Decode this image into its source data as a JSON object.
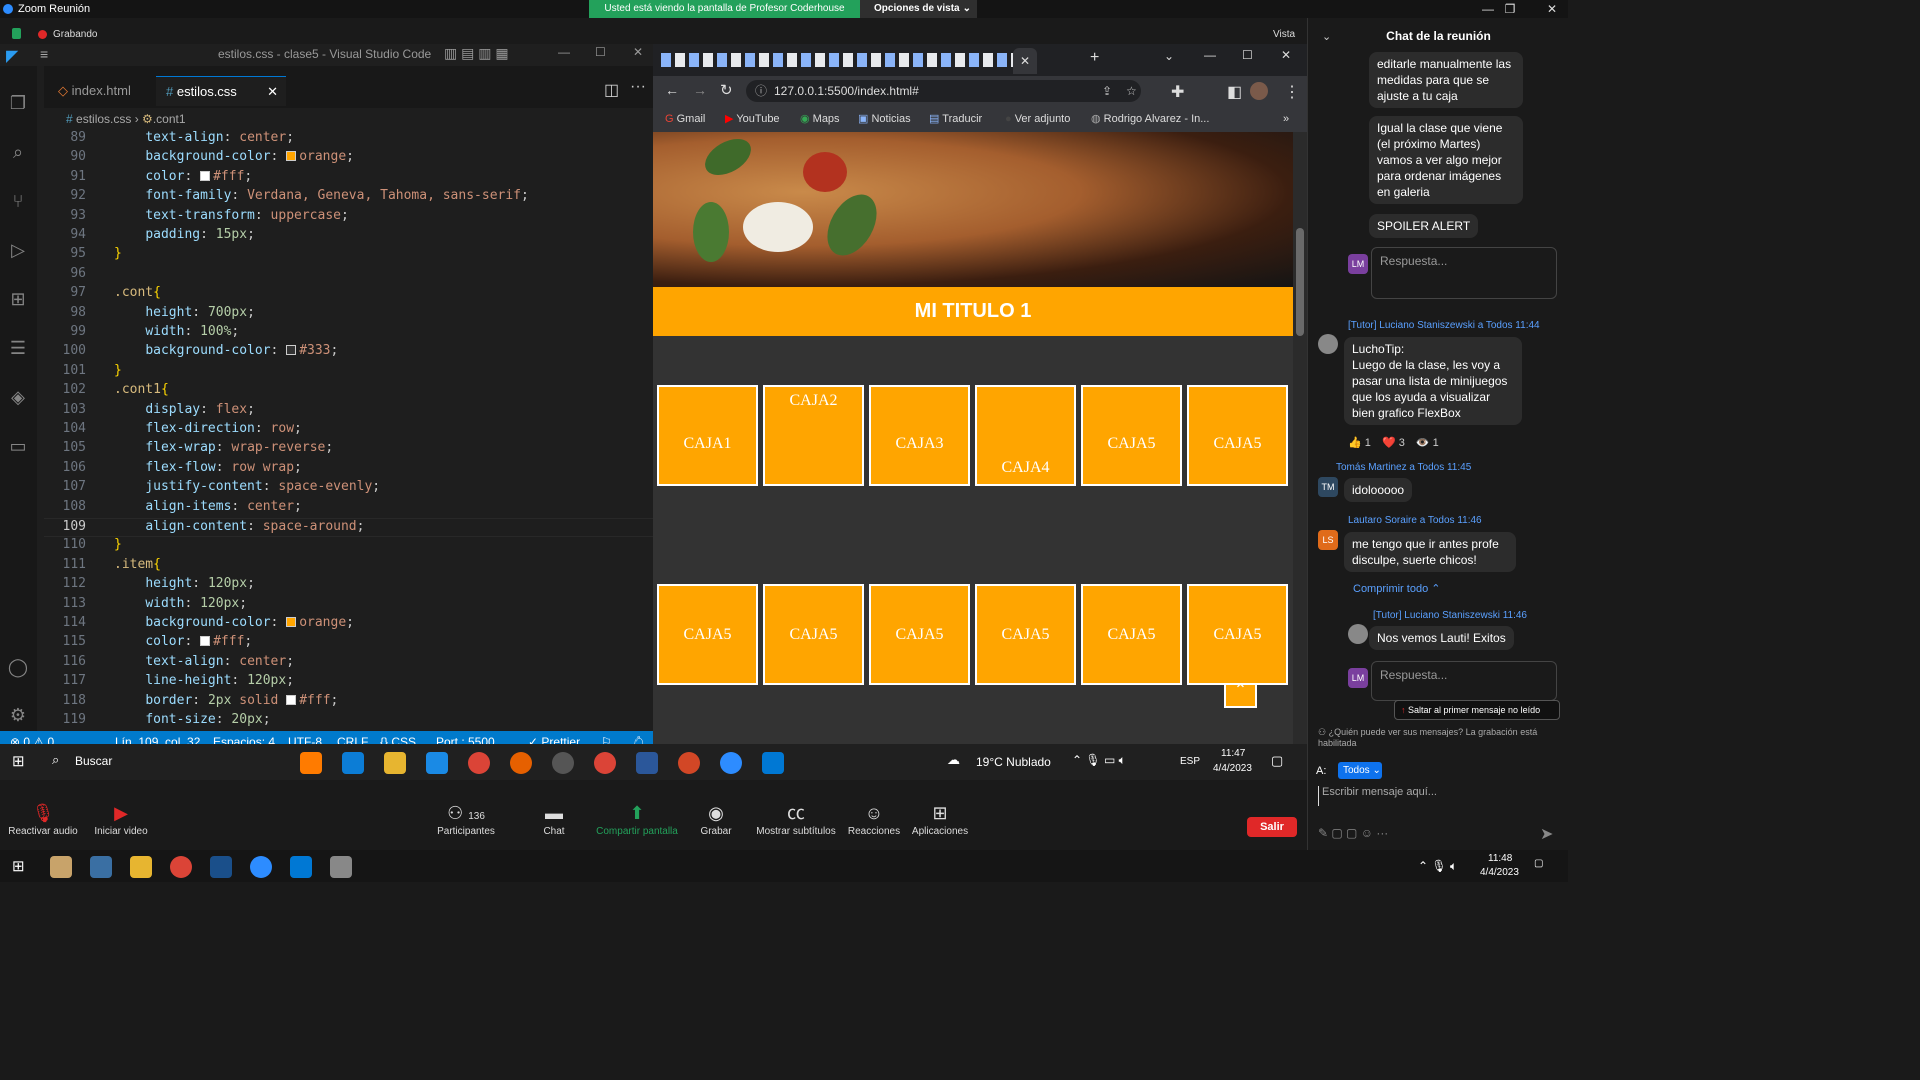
{
  "zoom": {
    "window_title": "Zoom Reunión",
    "share_banner": "Usted está viendo la pantalla de Profesor Coderhouse",
    "view_options": "Opciones de vista",
    "recording": "Grabando",
    "view_label": "Vista"
  },
  "vscode": {
    "title": "estilos.css - clase5 - Visual Studio Code",
    "tabs": [
      {
        "label": "index.html"
      },
      {
        "label": "estilos.css"
      }
    ],
    "breadcrumb": {
      "file": "estilos.css",
      "symbol": ".cont1"
    },
    "lines": [
      {
        "n": "89",
        "text": "    text-align: center;"
      },
      {
        "n": "90",
        "text": "    background-color: orange;"
      },
      {
        "n": "91",
        "text": "    color: #fff;"
      },
      {
        "n": "92",
        "text": "    font-family: Verdana, Geneva, Tahoma, sans-serif;"
      },
      {
        "n": "93",
        "text": "    text-transform: uppercase;"
      },
      {
        "n": "94",
        "text": "    padding: 15px;"
      },
      {
        "n": "95",
        "text": "}"
      },
      {
        "n": "96",
        "text": ""
      },
      {
        "n": "97",
        "text": ".cont{"
      },
      {
        "n": "98",
        "text": "    height: 700px;"
      },
      {
        "n": "99",
        "text": "    width: 100%;"
      },
      {
        "n": "100",
        "text": "    background-color: #333;"
      },
      {
        "n": "101",
        "text": "}"
      },
      {
        "n": "102",
        "text": ".cont1{"
      },
      {
        "n": "103",
        "text": "    display: flex;"
      },
      {
        "n": "104",
        "text": "    flex-direction: row;"
      },
      {
        "n": "105",
        "text": "    flex-wrap: wrap-reverse;"
      },
      {
        "n": "106",
        "text": "    flex-flow: row wrap;"
      },
      {
        "n": "107",
        "text": "    justify-content: space-evenly;"
      },
      {
        "n": "108",
        "text": "    align-items: center;"
      },
      {
        "n": "109",
        "text": "    align-content: space-around;"
      },
      {
        "n": "110",
        "text": "}"
      },
      {
        "n": "111",
        "text": ".item{"
      },
      {
        "n": "112",
        "text": "    height: 120px;"
      },
      {
        "n": "113",
        "text": "    width: 120px;"
      },
      {
        "n": "114",
        "text": "    background-color: orange;"
      },
      {
        "n": "115",
        "text": "    color: #fff;"
      },
      {
        "n": "116",
        "text": "    text-align: center;"
      },
      {
        "n": "117",
        "text": "    line-height: 120px;"
      },
      {
        "n": "118",
        "text": "    border: 2px solid #fff;"
      },
      {
        "n": "119",
        "text": "    font-size: 20px;"
      }
    ],
    "status": {
      "problems": "⊗ 0 ⚠ 0",
      "position": "Lín. 109, col. 32",
      "spaces": "Espacios: 4",
      "encoding": "UTF-8",
      "eol": "CRLF",
      "language": "{} CSS",
      "port": "Port : 5500",
      "prettier": "✓ Prettier"
    }
  },
  "browser": {
    "url": "127.0.0.1:5500/index.html#",
    "bookmarks": [
      "Gmail",
      "YouTube",
      "Maps",
      "Noticias",
      "Traducir",
      "Ver adjunto",
      "Rodrigo Alvarez - In..."
    ],
    "page_heading": "MI TITULO 1",
    "row1": [
      "CAJA1",
      "CAJA2",
      "CAJA3",
      "CAJA4",
      "CAJA5",
      "CAJA5"
    ],
    "row2": [
      "CAJA5",
      "CAJA5",
      "CAJA5",
      "CAJA5",
      "CAJA5",
      "CAJA5"
    ]
  },
  "inner_taskbar": {
    "search": "Buscar",
    "weather": "19°C  Nublado",
    "lang": "ESP",
    "time": "11:47",
    "date": "4/4/2023"
  },
  "chat": {
    "title": "Chat de la reunión",
    "msg1": "editarle manualmente las medidas para que se ajuste a tu caja",
    "msg2": "Igual la clase que viene (el próximo Martes) vamos a ver algo mejor para ordenar imágenes en galeria",
    "msg3": "SPOILER ALERT",
    "reply_placeholder": "Respuesta...",
    "tutor_meta": "[Tutor] Luciano Staniszewski a Todos 11:44",
    "tutor_msg": "LuchoTip:\nLuego de la clase, les voy a pasar una lista de minijuegos que los ayuda a visualizar bien grafico FlexBox",
    "reactions": [
      "👍 1",
      "❤️ 3",
      "👁️ 1"
    ],
    "tm_meta": "Tomás Martinez a Todos 11:45",
    "tm_msg": "idolooooo",
    "ls_meta": "Lautaro Soraire a Todos 11:46",
    "ls_msg": "me tengo que ir antes profe disculpe, suerte chicos!",
    "collapse": "Comprimir todo",
    "tutor2_meta": "[Tutor] Luciano Staniszewski 11:46",
    "tutor2_msg": "Nos vemos Lauti! Exitos",
    "jump_unread": "Saltar al primer mensaje no leído",
    "privacy": "¿Quién puede ver sus mensajes? La grabación está habilitada",
    "to_label": "A:",
    "to_value": "Todos",
    "input_placeholder": "Escribir mensaje aquí...",
    "avatars": {
      "lm": "LM",
      "tm": "TM",
      "ls": "LS"
    }
  },
  "zoom_toolbar": {
    "audio": "Reactivar audio",
    "video": "Iniciar video",
    "participants": "Participantes",
    "participants_count": "136",
    "chat": "Chat",
    "share": "Compartir pantalla",
    "record": "Grabar",
    "subtitles": "Mostrar subtítulos",
    "reactions": "Reacciones",
    "apps": "Aplicaciones",
    "leave": "Salir"
  },
  "os_taskbar": {
    "time": "11:48",
    "date": "4/4/2023"
  }
}
